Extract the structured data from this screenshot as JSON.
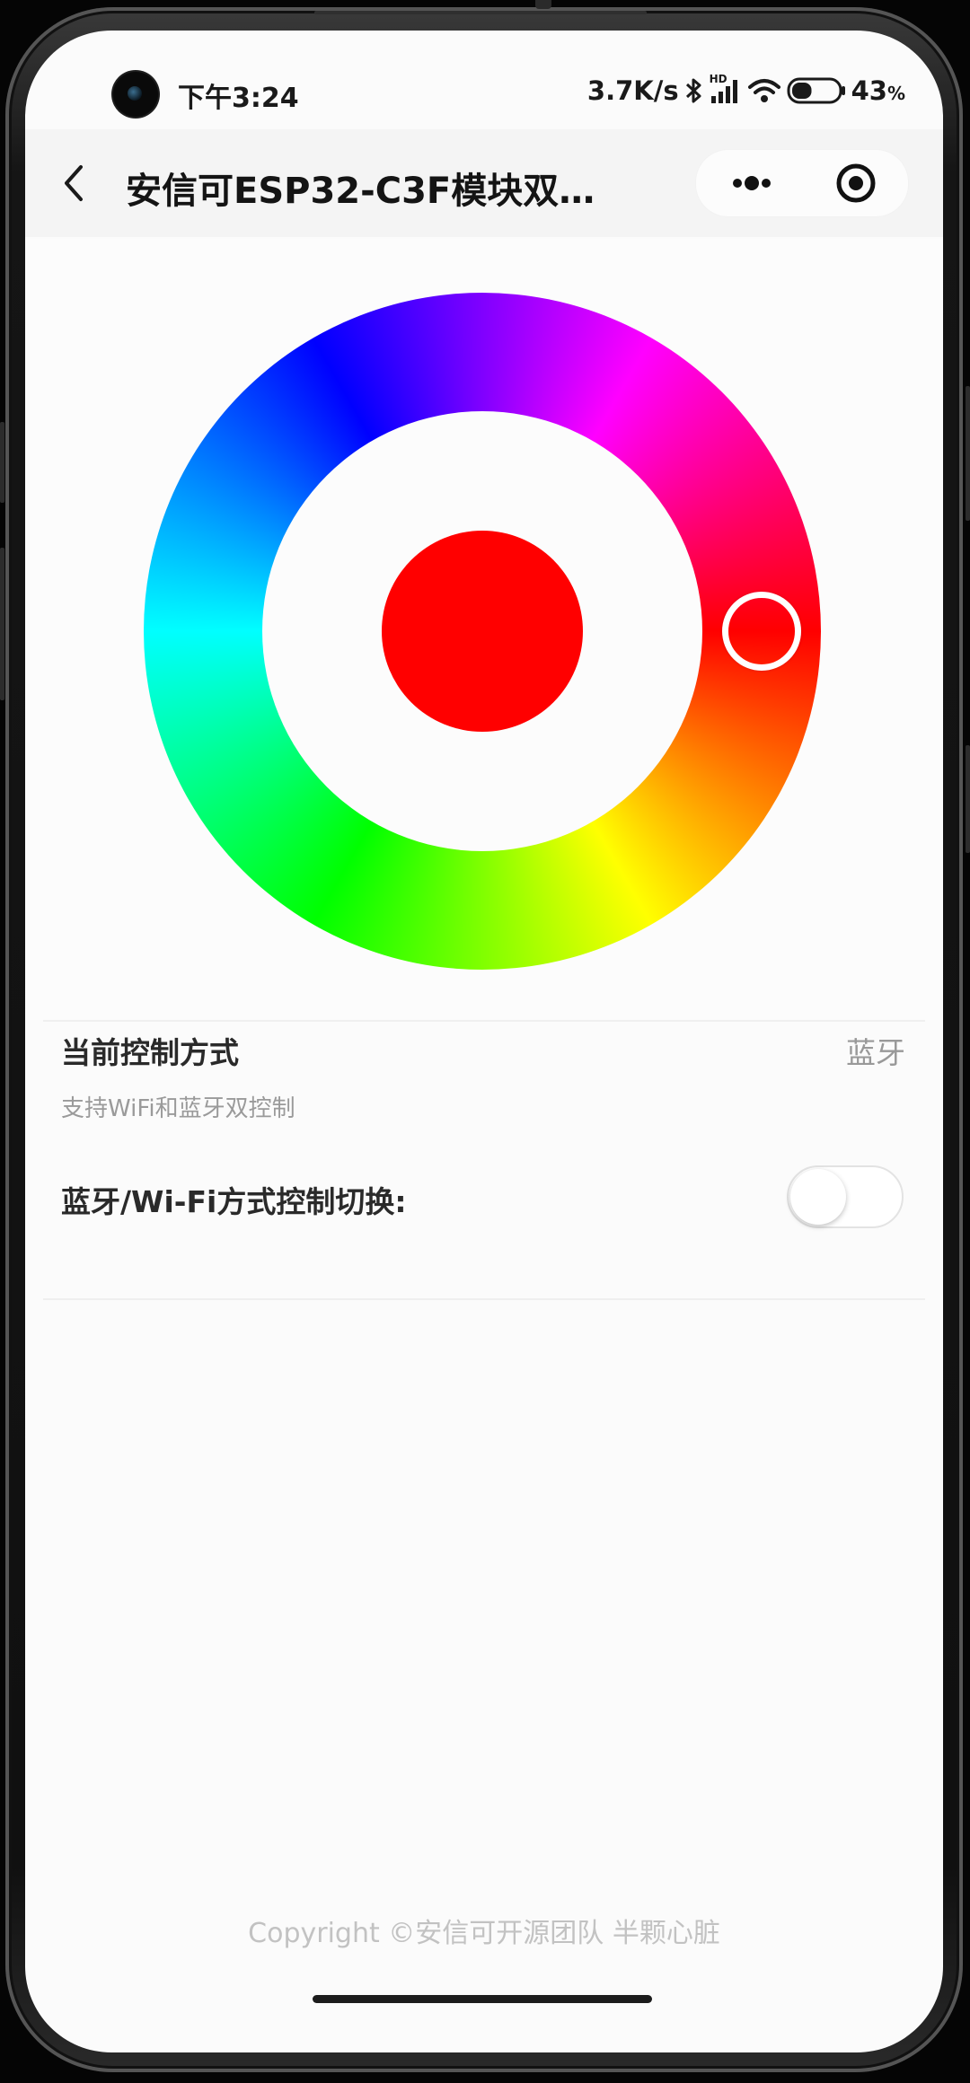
{
  "status_bar": {
    "time": "下午3:24",
    "network_speed": "3.7K/s",
    "hd_label": "HD",
    "battery_percent": "43",
    "battery_unit": "%",
    "battery_level": 0.43,
    "icons": [
      "camera-icon",
      "bluetooth-icon",
      "signal-icon",
      "wifi-icon",
      "battery-icon"
    ]
  },
  "nav": {
    "title": "安信可ESP32-C3F模块双…",
    "icons": [
      "back-icon",
      "more-icon",
      "close-miniprogram-icon"
    ]
  },
  "color_picker": {
    "selected_color": "#ff0000",
    "selected_hue_deg": 0
  },
  "control": {
    "label": "当前控制方式",
    "value": "蓝牙",
    "description": "支持WiFi和蓝牙双控制",
    "switch_label": "蓝牙/Wi-Fi方式控制切换:",
    "switch_on": false
  },
  "footer": {
    "copyright": "Copyright ©安信可开源团队 半颗心脏"
  }
}
